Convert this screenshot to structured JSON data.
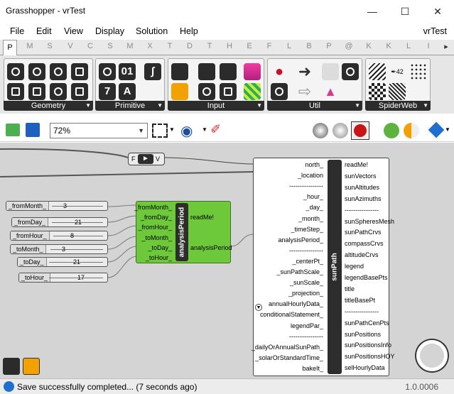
{
  "window": {
    "title": "Grasshopper - vrTest"
  },
  "menubar": {
    "items": [
      "File",
      "Edit",
      "View",
      "Display",
      "Solution",
      "Help"
    ],
    "document": "vrTest"
  },
  "tabs": [
    "P",
    "M",
    "S",
    "V",
    "C",
    "S",
    "M",
    "X",
    "T",
    "D",
    "T",
    "H",
    "E",
    "F",
    "L",
    "B",
    "P",
    "@",
    "K",
    "K",
    "L",
    "I"
  ],
  "ribbon": {
    "groups": [
      "Geometry",
      "Primitive",
      "Input",
      "Util",
      "SpiderWeb"
    ]
  },
  "toolbar": {
    "zoom": "72%"
  },
  "canvas": {
    "sliders": [
      {
        "label": "_fromMonth_",
        "value": "3"
      },
      {
        "label": "_fromDay_",
        "value": "21"
      },
      {
        "label": "_fromHour_",
        "value": "8"
      },
      {
        "label": "_toMonth_",
        "value": "3"
      },
      {
        "label": "_toDay_",
        "value": "21"
      },
      {
        "label": "_toHour_",
        "value": "17"
      }
    ],
    "toggle": {
      "left": "F",
      "right": "V"
    },
    "analysis_period": {
      "name": "analysisPeriod",
      "inputs": [
        "_fromMonth_",
        "_fromDay_",
        "_fromHour_",
        "_toMonth_",
        "_toDay_",
        "_toHour_"
      ],
      "outputs": [
        "readMe!",
        "analysisPeriod"
      ]
    },
    "sunpath": {
      "name": "sunPath",
      "inputs": [
        "north_",
        "_location",
        "----------------",
        "_hour_",
        "_day_",
        "_month_",
        "_timeStep_",
        "analysisPeriod_",
        "----------------",
        "_centerPt_",
        "_sunPathScale_",
        "_sunScale_",
        "_projection_",
        "annualHourlyData_",
        "conditionalStatement_",
        "legendPar_",
        "----------------",
        "_dailyOrAnnualSunPath_",
        "_solarOrStandardTime_",
        "bakeIt_"
      ],
      "outputs": [
        "readMe!",
        "sunVectors",
        "sunAltitudes",
        "sunAzimuths",
        "----------------",
        "sunSpheresMesh",
        "sunPathCrvs",
        "compassCrvs",
        "altitudeCrvs",
        "legend",
        "legendBasePts",
        "title",
        "titleBasePt",
        "----------------",
        "sunPathCenPts",
        "sunPositions",
        "sunPositionsInfo",
        "sunPositionsHOY",
        "selHourlyData"
      ]
    }
  },
  "status": {
    "message": "Save successfully completed... (7 seconds ago)",
    "version": "1.0.0006"
  }
}
